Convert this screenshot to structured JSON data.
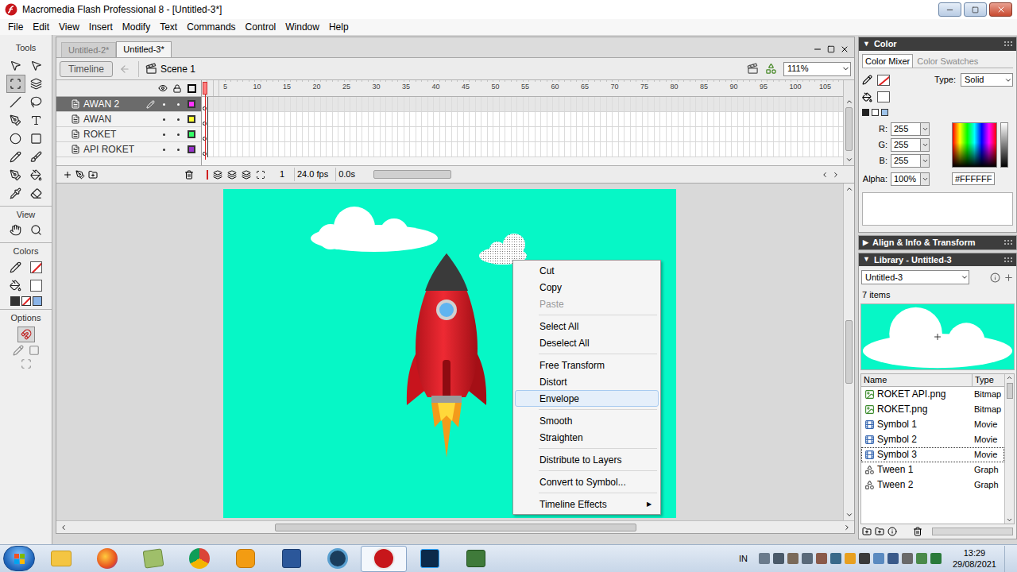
{
  "window": {
    "title": "Macromedia Flash Professional 8 - [Untitled-3*]"
  },
  "menu": [
    "File",
    "Edit",
    "View",
    "Insert",
    "Modify",
    "Text",
    "Commands",
    "Control",
    "Window",
    "Help"
  ],
  "tools": {
    "title": "Tools",
    "sections": [
      "View",
      "Colors",
      "Options"
    ]
  },
  "documents": [
    {
      "label": "Untitled-2*",
      "selected": false
    },
    {
      "label": "Untitled-3*",
      "selected": true
    }
  ],
  "edit_bar": {
    "timeline_button": "Timeline",
    "scene": "Scene 1",
    "zoom": "111%"
  },
  "timeline": {
    "ruler": [
      "5",
      "10",
      "15",
      "20",
      "25",
      "30",
      "35",
      "40",
      "45",
      "50",
      "55",
      "60",
      "65",
      "70",
      "75",
      "80",
      "85",
      "90",
      "95",
      "100",
      "105"
    ],
    "layers": [
      {
        "name": "AWAN 2",
        "selected": true,
        "color": "#ff33ff"
      },
      {
        "name": "AWAN",
        "selected": false,
        "color": "#ffff33"
      },
      {
        "name": "ROKET",
        "selected": false,
        "color": "#33ff66"
      },
      {
        "name": "API ROKET",
        "selected": false,
        "color": "#9933cc"
      }
    ],
    "current_frame": "1",
    "fps": "24.0 fps",
    "elapsed": "0.0s"
  },
  "context_menu": {
    "submenu_arrow": "▶",
    "groups": [
      [
        {
          "label": "Cut",
          "disabled": false,
          "hovered": false,
          "submenu": false
        },
        {
          "label": "Copy",
          "disabled": false,
          "hovered": false,
          "submenu": false
        },
        {
          "label": "Paste",
          "disabled": true,
          "hovered": false,
          "submenu": false
        }
      ],
      [
        {
          "label": "Select All",
          "disabled": false,
          "hovered": false,
          "submenu": false
        },
        {
          "label": "Deselect All",
          "disabled": false,
          "hovered": false,
          "submenu": false
        }
      ],
      [
        {
          "label": "Free Transform",
          "disabled": false,
          "hovered": false,
          "submenu": false
        },
        {
          "label": "Distort",
          "disabled": false,
          "hovered": false,
          "submenu": false
        },
        {
          "label": "Envelope",
          "disabled": false,
          "hovered": true,
          "submenu": false
        }
      ],
      [
        {
          "label": "Smooth",
          "disabled": false,
          "hovered": false,
          "submenu": false
        },
        {
          "label": "Straighten",
          "disabled": false,
          "hovered": false,
          "submenu": false
        }
      ],
      [
        {
          "label": "Distribute to Layers",
          "disabled": false,
          "hovered": false,
          "submenu": false
        }
      ],
      [
        {
          "label": "Convert to Symbol...",
          "disabled": false,
          "hovered": false,
          "submenu": false
        }
      ],
      [
        {
          "label": "Timeline Effects",
          "disabled": false,
          "hovered": false,
          "submenu": true
        }
      ]
    ]
  },
  "color_panel": {
    "title": "Color",
    "toggle": "▼",
    "expanded": true,
    "tabs": [
      {
        "label": "Color Mixer",
        "selected": true
      },
      {
        "label": "Color Swatches",
        "selected": false
      }
    ],
    "type_label": "Type:",
    "type_value": "Solid",
    "channels": [
      {
        "label": "R:",
        "value": "255"
      },
      {
        "label": "G:",
        "value": "255"
      },
      {
        "label": "B:",
        "value": "255"
      }
    ],
    "alpha": {
      "label": "Alpha:",
      "value": "100%"
    },
    "hex": "#FFFFFF",
    "color": "#ffffff"
  },
  "align_panel": {
    "title": "Align & Info & Transform",
    "toggle": "▶",
    "expanded": false
  },
  "library": {
    "title": "Library - Untitled-3",
    "toggle": "▼",
    "expanded": true,
    "document": "Untitled-3",
    "count": "7 items",
    "columns": [
      "Name",
      "Type"
    ],
    "items": [
      {
        "name": "ROKET API.png",
        "type": "Bitmap",
        "kind": "bitmap",
        "focused": false
      },
      {
        "name": "ROKET.png",
        "type": "Bitmap",
        "kind": "bitmap",
        "focused": false
      },
      {
        "name": "Symbol 1",
        "type": "Movie",
        "kind": "movie",
        "focused": false
      },
      {
        "name": "Symbol 2",
        "type": "Movie",
        "kind": "movie",
        "focused": false
      },
      {
        "name": "Symbol 3",
        "type": "Movie",
        "kind": "movie",
        "focused": true
      },
      {
        "name": "Tween 1",
        "type": "Graph",
        "kind": "graphic",
        "focused": false
      },
      {
        "name": "Tween 2",
        "type": "Graph",
        "kind": "graphic",
        "focused": false
      }
    ]
  },
  "taskbar": {
    "language": "IN",
    "time": "13:29",
    "date": "29/08/2021",
    "apps": [
      {
        "kind": "explorer",
        "active": false
      },
      {
        "kind": "firefox",
        "active": false
      },
      {
        "kind": "notes",
        "active": false
      },
      {
        "kind": "chrome",
        "active": false
      },
      {
        "kind": "media",
        "active": false
      },
      {
        "kind": "word",
        "active": false
      },
      {
        "kind": "webcam",
        "active": false
      },
      {
        "kind": "flash",
        "active": true
      },
      {
        "kind": "photoshop",
        "active": false
      },
      {
        "kind": "recorder",
        "active": false
      }
    ]
  }
}
